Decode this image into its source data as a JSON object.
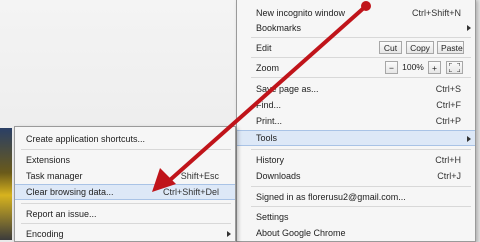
{
  "main_menu": {
    "new_incognito": {
      "label": "New incognito window",
      "shortcut": "Ctrl+Shift+N"
    },
    "bookmarks": {
      "label": "Bookmarks"
    },
    "edit": {
      "label": "Edit",
      "cut": "Cut",
      "copy": "Copy",
      "paste": "Paste"
    },
    "zoom": {
      "label": "Zoom",
      "minus": "−",
      "value": "100%",
      "plus": "+"
    },
    "save_page": {
      "label": "Save page as...",
      "shortcut": "Ctrl+S"
    },
    "find": {
      "label": "Find...",
      "shortcut": "Ctrl+F"
    },
    "print": {
      "label": "Print...",
      "shortcut": "Ctrl+P"
    },
    "tools": {
      "label": "Tools"
    },
    "history": {
      "label": "History",
      "shortcut": "Ctrl+H"
    },
    "downloads": {
      "label": "Downloads",
      "shortcut": "Ctrl+J"
    },
    "signed_in": {
      "label": "Signed in as florerusu2@gmail.com..."
    },
    "settings": {
      "label": "Settings"
    },
    "about": {
      "label": "About Google Chrome"
    }
  },
  "tools_submenu": {
    "create_shortcuts": {
      "label": "Create application shortcuts..."
    },
    "extensions": {
      "label": "Extensions"
    },
    "task_manager": {
      "label": "Task manager",
      "shortcut": "Shift+Esc"
    },
    "clear_data": {
      "label": "Clear browsing data...",
      "shortcut": "Ctrl+Shift+Del"
    },
    "report_issue": {
      "label": "Report an issue..."
    },
    "encoding": {
      "label": "Encoding"
    }
  },
  "colors": {
    "annotation_arrow": "#c0141a",
    "highlight": "#dde8f7"
  }
}
